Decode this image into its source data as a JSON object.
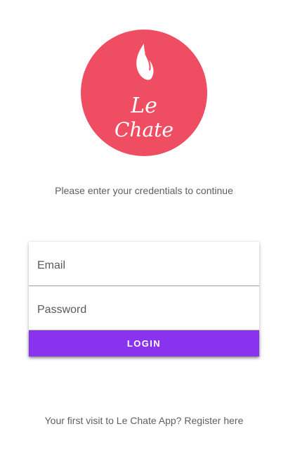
{
  "logo": {
    "brand_line1": "Le",
    "brand_line2": "Chate",
    "background_color": "#ee4d62",
    "icon": "flame-icon"
  },
  "subtitle": "Please enter your credentials to continue",
  "form": {
    "email_placeholder": "Email",
    "password_placeholder": "Password",
    "login_label": "LOGIN",
    "button_color": "#8a33ee"
  },
  "footer": {
    "prompt": "Your first visit to Le Chate App?",
    "register_link": "Register here"
  }
}
